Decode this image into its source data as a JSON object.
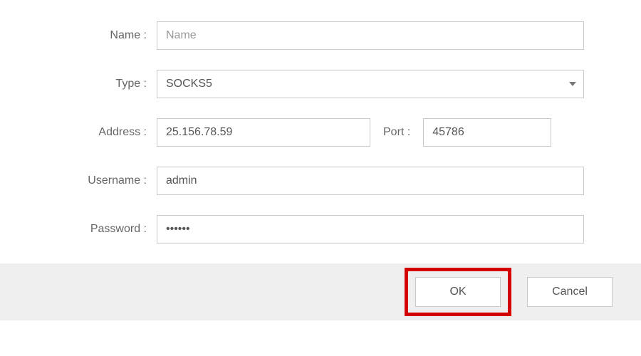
{
  "labels": {
    "name": "Name :",
    "type": "Type :",
    "address": "Address :",
    "port": "Port :",
    "username": "Username :",
    "password": "Password :"
  },
  "fields": {
    "name_placeholder": "Name",
    "name_value": "",
    "type_selected": "SOCKS5",
    "address_value": "25.156.78.59",
    "port_value": "45786",
    "username_value": "admin",
    "password_value": "••••••"
  },
  "buttons": {
    "ok": "OK",
    "cancel": "Cancel"
  }
}
